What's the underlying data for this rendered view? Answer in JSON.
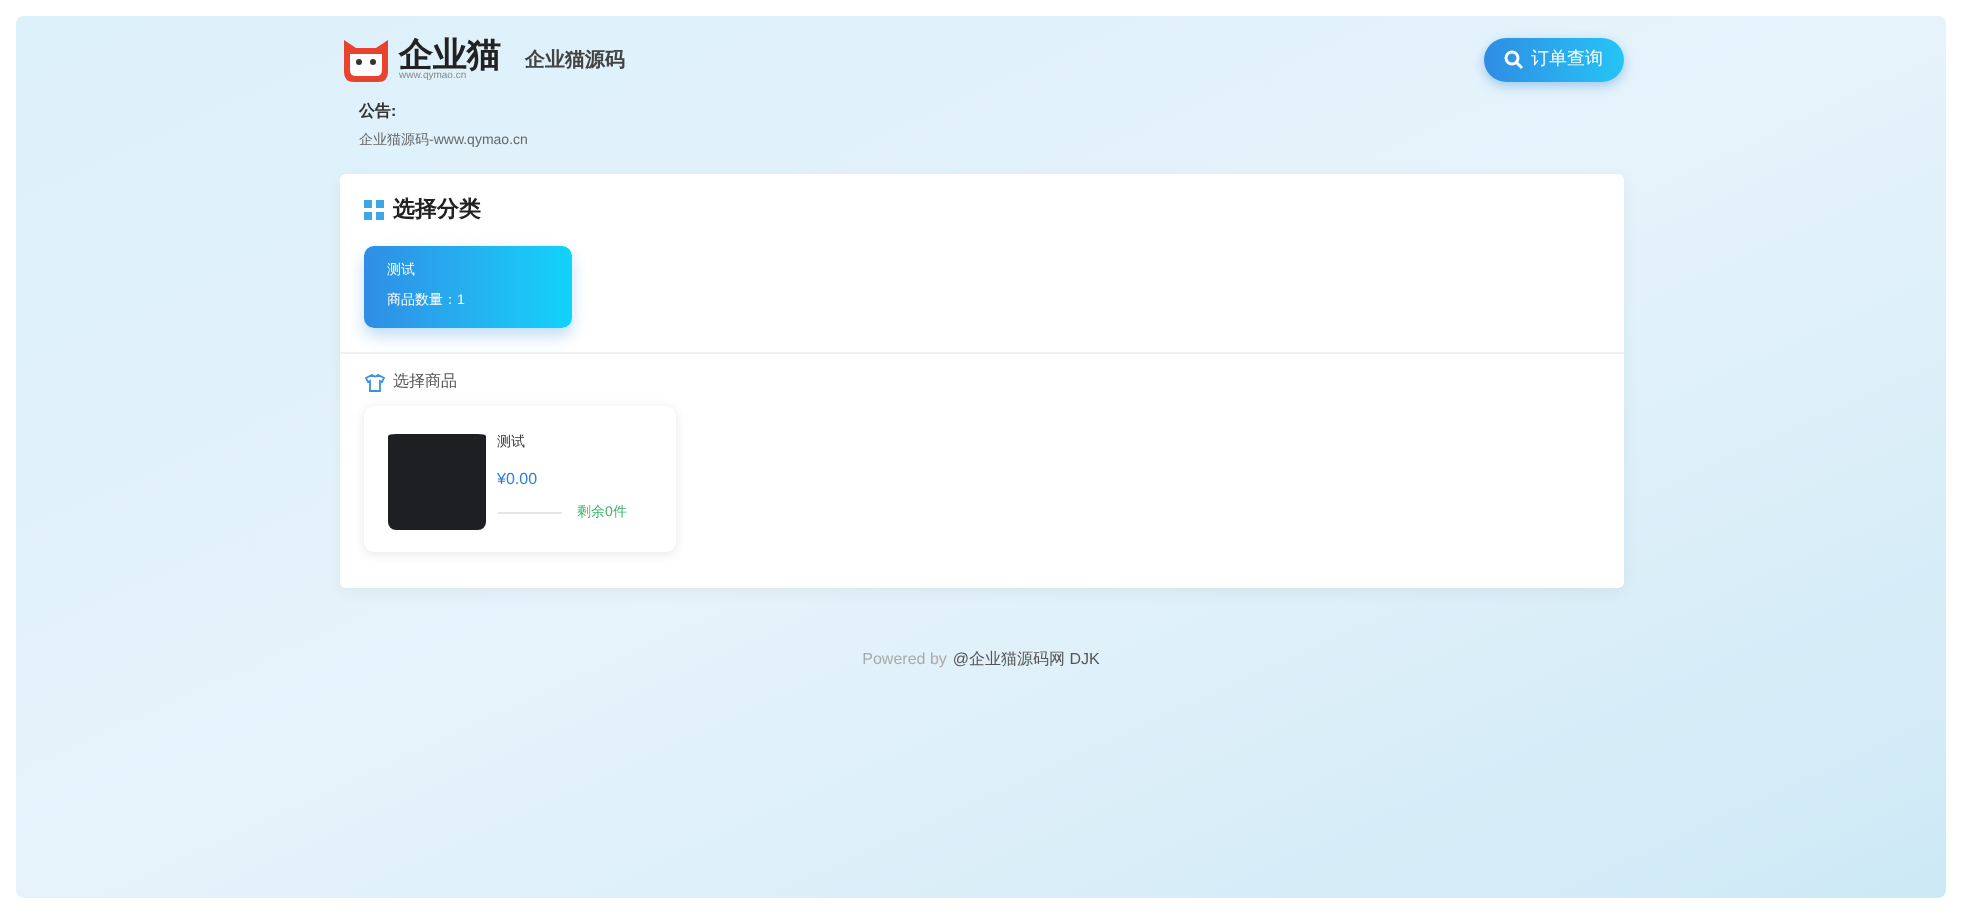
{
  "header": {
    "logo_text": "企业猫",
    "logo_subtext": "www.qymao.cn",
    "site_name": "企业猫源码",
    "order_button": "订单查询"
  },
  "notice": {
    "title": "公告:",
    "text": "企业猫源码-www.qymao.cn"
  },
  "categories": {
    "title": "选择分类",
    "items": [
      {
        "name": "测试",
        "count_label": "商品数量：1",
        "selected": true
      }
    ]
  },
  "products": {
    "title": "选择商品",
    "items": [
      {
        "name": "测试",
        "price": "¥0.00",
        "stock": "剩余0件",
        "level": 0
      }
    ]
  },
  "footer": {
    "prefix": "Powered by",
    "link": "@企业猫源码网 DJK"
  }
}
